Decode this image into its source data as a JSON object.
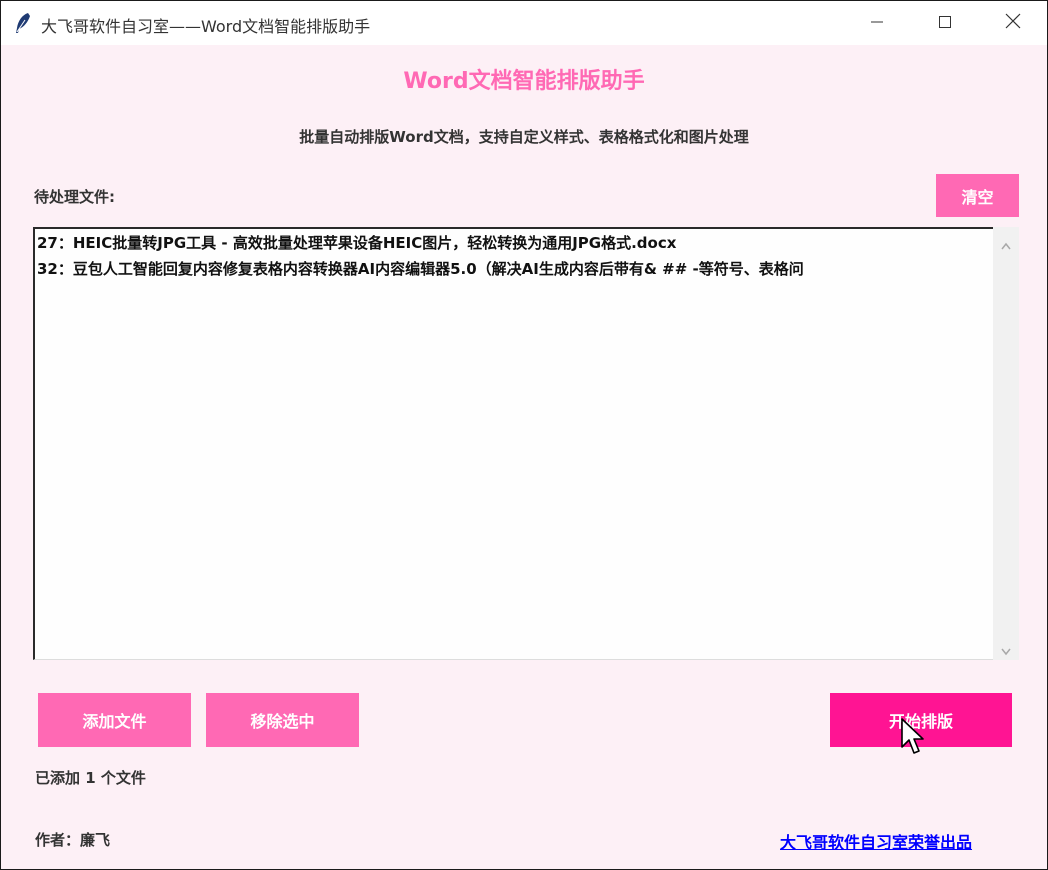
{
  "window": {
    "title": "大飞哥软件自习室——Word文档智能排版助手",
    "icon": "feather-icon",
    "controls": [
      "minimize-icon",
      "maximize-icon",
      "close-icon"
    ]
  },
  "header": {
    "title": "Word文档智能排版助手",
    "subtitle": "批量自动排版Word文档，支持自定义样式、表格格式化和图片处理"
  },
  "files": {
    "label": "待处理文件:",
    "clear_label": "清空",
    "items": [
      "27：HEIC批量转JPG工具 - 高效批量处理苹果设备HEIC图片，轻松转换为通用JPG格式.docx",
      "32：豆包人工智能回复内容修复表格内容转换器AI内容编辑器5.0（解决AI生成内容后带有& ## -等符号、表格问"
    ]
  },
  "actions": {
    "add_label": "添加文件",
    "remove_label": "移除选中",
    "start_label": "开始排版"
  },
  "status": {
    "text": "已添加 1 个文件"
  },
  "footer": {
    "author": "作者：廉飞",
    "brand": "大飞哥软件自习室荣誉出品"
  },
  "colors": {
    "background": "#fdf0f6",
    "accent": "#ff69b4",
    "primary": "#ff1493",
    "link": "#0000ff"
  }
}
